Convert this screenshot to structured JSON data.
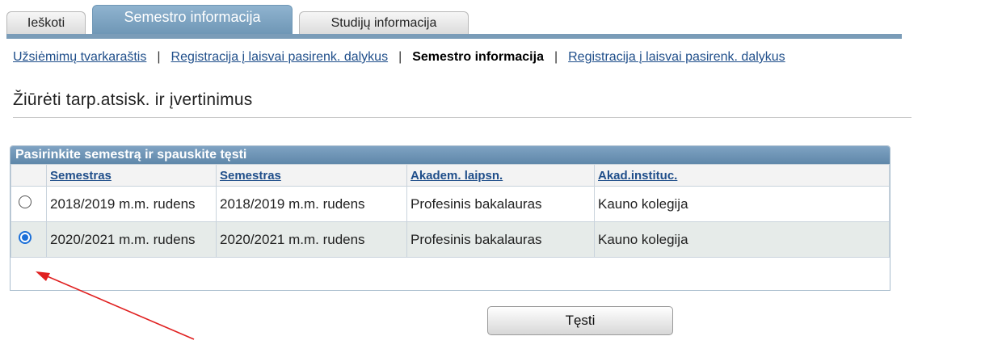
{
  "tabs": [
    {
      "label": "Ieškoti"
    },
    {
      "label": "Semestro informacija"
    },
    {
      "label": "Studijų informacija"
    }
  ],
  "subnav": [
    {
      "label": "Užsiėmimų tvarkaraštis"
    },
    {
      "label": "Registracija į laisvai pasirenk. dalykus"
    },
    {
      "label": "Semestro informacija"
    },
    {
      "label": "Registracija į laisvai pasirenk. dalykus"
    }
  ],
  "page_title": "Žiūrėti tarp.atsisk. ir įvertinimus",
  "grid": {
    "caption": "Pasirinkite semestrą ir spauskite tęsti",
    "columns": [
      "Semestras",
      "Semestras",
      "Akadem. laipsn.",
      "Akad.instituc."
    ],
    "rows": [
      {
        "selected": false,
        "col1": "2018/2019 m.m. rudens",
        "col2": "2018/2019 m.m. rudens",
        "col3": "Profesinis bakalauras",
        "col4": "Kauno kolegija"
      },
      {
        "selected": true,
        "col1": "2020/2021 m.m. rudens",
        "col2": "2020/2021 m.m. rudens",
        "col3": "Profesinis bakalauras",
        "col4": "Kauno kolegija"
      }
    ]
  },
  "continue_button": "Tęsti",
  "colors": {
    "tab_active": "#7a9cb8",
    "link": "#1f4e8a",
    "arrow": "#e02020",
    "radio_selected": "#1b6fd8"
  }
}
